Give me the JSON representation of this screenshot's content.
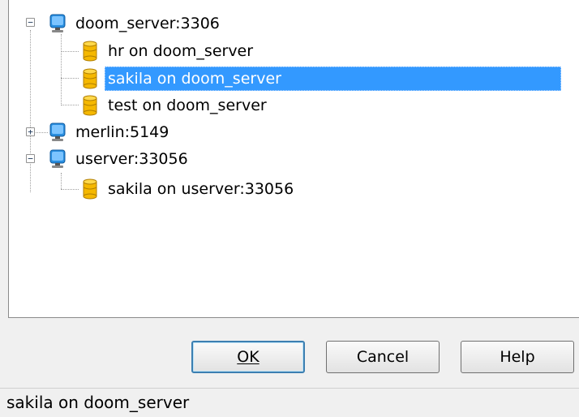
{
  "tree": {
    "nodes": [
      {
        "label": "doom_server:3306",
        "kind": "server",
        "expanded": true,
        "level": 0
      },
      {
        "label": "hr on doom_server",
        "kind": "database",
        "level": 1
      },
      {
        "label": "sakila on doom_server",
        "kind": "database",
        "level": 1,
        "selected": true
      },
      {
        "label": "test on doom_server",
        "kind": "database",
        "level": 1
      },
      {
        "label": "merlin:5149",
        "kind": "server",
        "expanded": false,
        "level": 0
      },
      {
        "label": "userver:33056",
        "kind": "server",
        "expanded": true,
        "level": 0
      },
      {
        "label": "sakila on userver:33056",
        "kind": "database",
        "level": 1
      }
    ],
    "expanded_glyph": "−",
    "collapsed_glyph": "+"
  },
  "buttons": {
    "ok_label": "OK",
    "cancel_label": "Cancel",
    "help_label": "Help"
  },
  "status_bar": {
    "text": "sakila on doom_server"
  },
  "icons": {
    "server": "server-monitor-icon",
    "database": "database-cylinder-icon"
  },
  "colors": {
    "selection": "#3399ff",
    "database": "#f5b800",
    "server": "#2a8fe0"
  }
}
